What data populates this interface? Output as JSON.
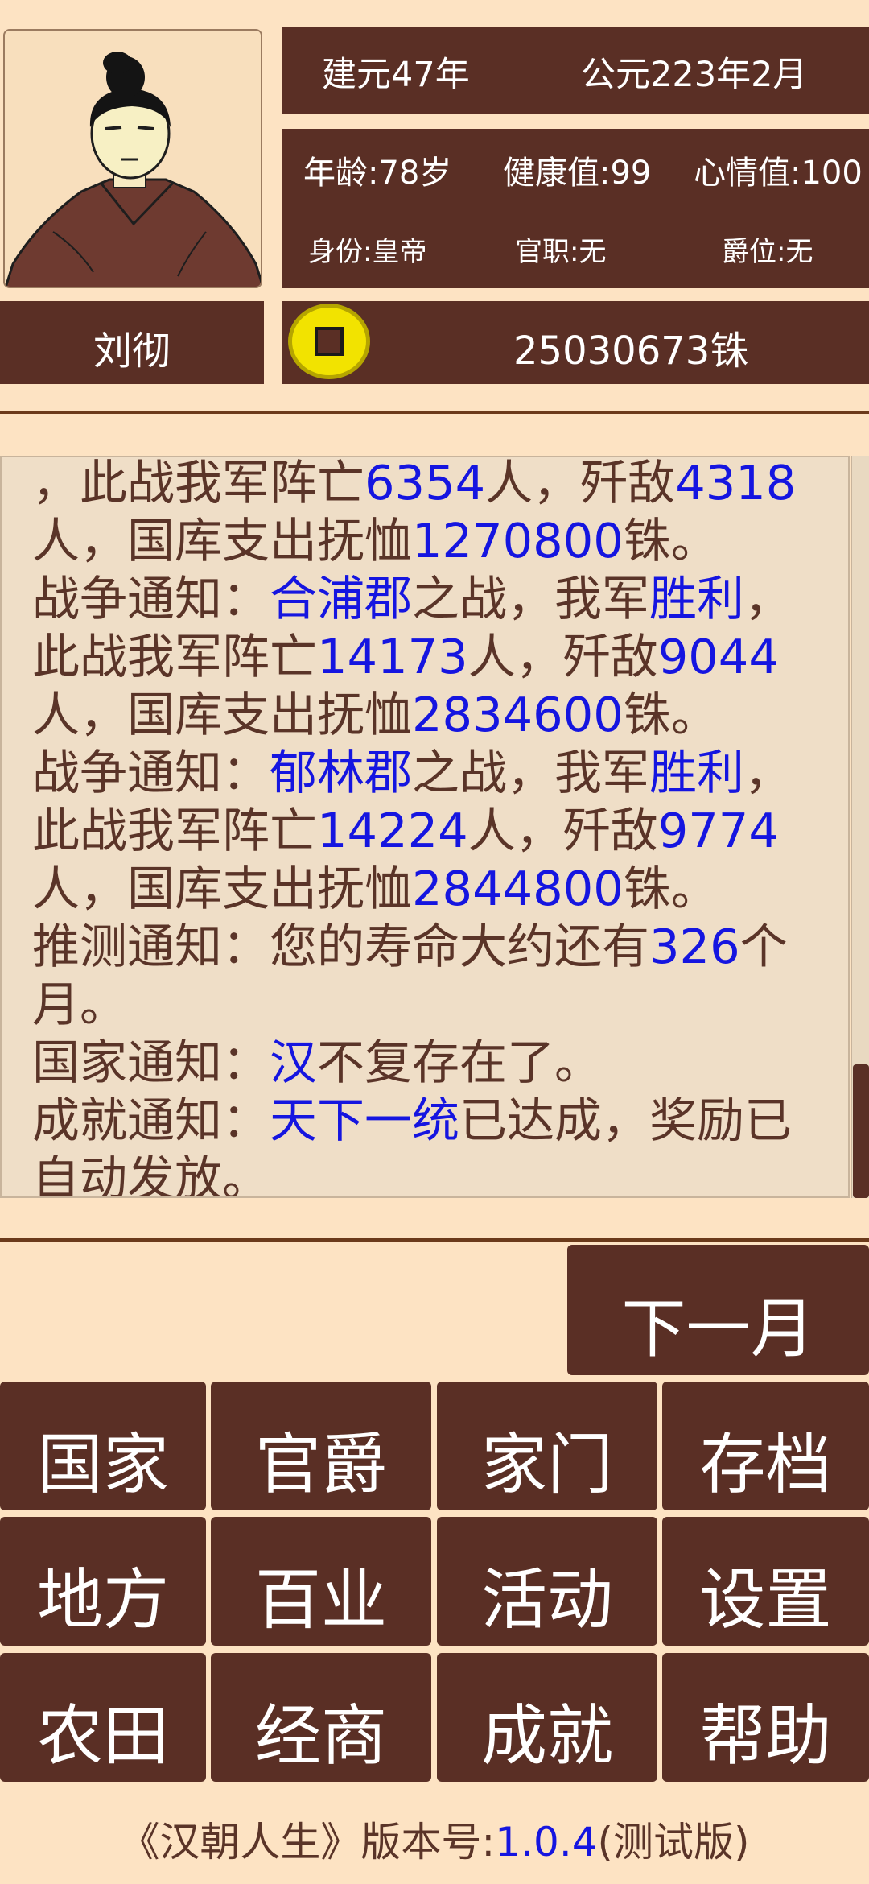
{
  "header": {
    "era": "建元47年",
    "ad_date": "公元223年2月",
    "age": "年龄:78岁",
    "health": "健康值:99",
    "mood": "心情值:100",
    "identity": "身份:皇帝",
    "office": "官职:无",
    "rank": "爵位:无",
    "name": "刘彻",
    "money": "25030673铢"
  },
  "log": [
    {
      "t": "，此战我军阵亡"
    },
    {
      "t": "6354",
      "hl": true
    },
    {
      "t": "人，歼敌"
    },
    {
      "t": "4318",
      "hl": true
    },
    {
      "t": "人，国库支出抚恤"
    },
    {
      "t": "1270800",
      "hl": true
    },
    {
      "t": "铢。"
    },
    {
      "br": true
    },
    {
      "t": "战争通知："
    },
    {
      "t": "合浦郡",
      "hl": true
    },
    {
      "t": "之战，我军"
    },
    {
      "t": "胜利",
      "hl": true
    },
    {
      "t": "，此战我军阵亡"
    },
    {
      "t": "14173",
      "hl": true
    },
    {
      "t": "人，歼敌"
    },
    {
      "t": "9044",
      "hl": true
    },
    {
      "t": "人，国库支出抚恤"
    },
    {
      "t": "2834600",
      "hl": true
    },
    {
      "t": "铢。"
    },
    {
      "br": true
    },
    {
      "t": "战争通知："
    },
    {
      "t": "郁林郡",
      "hl": true
    },
    {
      "t": "之战，我军"
    },
    {
      "t": "胜利",
      "hl": true
    },
    {
      "t": "，此战我军阵亡"
    },
    {
      "t": "14224",
      "hl": true
    },
    {
      "t": "人，歼敌"
    },
    {
      "t": "9774",
      "hl": true
    },
    {
      "t": "人，国库支出抚恤"
    },
    {
      "t": "2844800",
      "hl": true
    },
    {
      "t": "铢。"
    },
    {
      "br": true
    },
    {
      "t": "推测通知：您的寿命大约还有"
    },
    {
      "t": "326",
      "hl": true
    },
    {
      "t": "个月。"
    },
    {
      "br": true
    },
    {
      "t": "国家通知："
    },
    {
      "t": "汉",
      "hl": true
    },
    {
      "t": "不复存在了。"
    },
    {
      "br": true
    },
    {
      "t": "成就通知："
    },
    {
      "t": "天下一统",
      "hl": true
    },
    {
      "t": "已达成，奖励已自动发放。"
    }
  ],
  "next_month": "下一月",
  "menu": [
    "国家",
    "官爵",
    "家门",
    "存档",
    "地方",
    "百业",
    "活动",
    "设置",
    "农田",
    "经商",
    "成就",
    "帮助"
  ],
  "version": {
    "prefix": "《汉朝人生》版本号:",
    "number": "1.0.4",
    "suffix": "(测试版)"
  },
  "colors": {
    "panel": "#5a2f25",
    "background": "#fde3c3",
    "highlight": "#1515e0",
    "log_text": "#5a3428",
    "coin": "#f2e300"
  }
}
